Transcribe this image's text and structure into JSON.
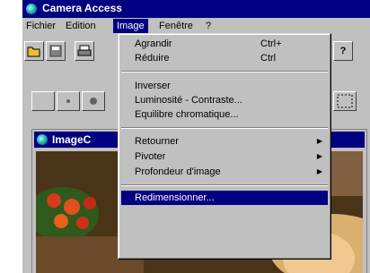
{
  "window": {
    "title": "Camera Access"
  },
  "menubar": {
    "items": [
      {
        "label": "Fichier"
      },
      {
        "label": "Edition"
      },
      {
        "label": "Image"
      },
      {
        "label": "Fenêtre"
      },
      {
        "label": "?"
      }
    ]
  },
  "toolbar": {
    "help_label": "?"
  },
  "child_window": {
    "title": "ImageC"
  },
  "image_menu": {
    "items": [
      {
        "label": "Agrandir",
        "shortcut": "Ctrl+"
      },
      {
        "label": "Réduire",
        "shortcut": "Ctrl"
      },
      {
        "label": "Inverser"
      },
      {
        "label": "Luminosité - Contraste..."
      },
      {
        "label": "Equilibre chromatique..."
      },
      {
        "label": "Retourner"
      },
      {
        "label": "Pivoter"
      },
      {
        "label": "Profondeur d'image"
      },
      {
        "label": "Redimensionner..."
      }
    ]
  },
  "icons": [
    "app-icon",
    "open-folder-icon",
    "save-icon",
    "print-icon",
    "help-icon",
    "selection-icon",
    "submenu-arrow-icon"
  ],
  "colors": {
    "titlebar": "#000080",
    "highlight": "#000080",
    "face": "#c0c0c0"
  }
}
